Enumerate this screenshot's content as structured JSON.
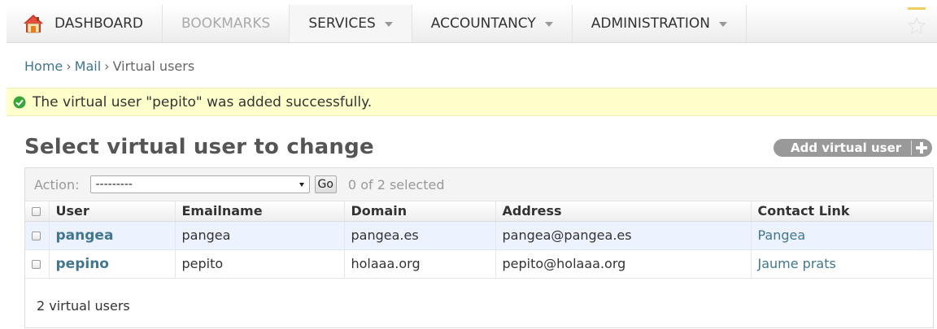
{
  "nav": {
    "items": [
      {
        "label": "DASHBOARD",
        "state": "normal"
      },
      {
        "label": "BOOKMARKS",
        "state": "disabled"
      },
      {
        "label": "SERVICES",
        "state": "active"
      },
      {
        "label": "ACCOUNTANCY",
        "state": "normal"
      },
      {
        "label": "ADMINISTRATION",
        "state": "normal"
      }
    ],
    "icons": {
      "home": "home-icon",
      "star": "star-icon"
    }
  },
  "breadcrumb": {
    "home": "Home",
    "mail": "Mail",
    "current": "Virtual users",
    "separator": "›"
  },
  "message": {
    "text": "The virtual user \"pepito\" was added successfully.",
    "icon": "success-check-icon",
    "color": "#ffffcc"
  },
  "page": {
    "title": "Select virtual user to change",
    "add_button_label": "Add virtual user"
  },
  "actions": {
    "label": "Action:",
    "selected_option": "---------",
    "go_label": "Go",
    "counter": "0 of 2 selected"
  },
  "table": {
    "headers": [
      "User",
      "Emailname",
      "Domain",
      "Address",
      "Contact Link"
    ],
    "rows": [
      {
        "user": "pangea",
        "emailname": "pangea",
        "domain": "pangea.es",
        "address": "pangea@pangea.es",
        "contact": "Pangea"
      },
      {
        "user": "pepino",
        "emailname": "pepito",
        "domain": "holaaa.org",
        "address": "pepito@holaaa.org",
        "contact": "Jaume prats"
      }
    ]
  },
  "paginator": {
    "text": "2 virtual users"
  },
  "colors": {
    "link": "#417690",
    "message_bg": "#ffffcc",
    "row_highlight": "#edf3fe",
    "button": "#999999"
  }
}
